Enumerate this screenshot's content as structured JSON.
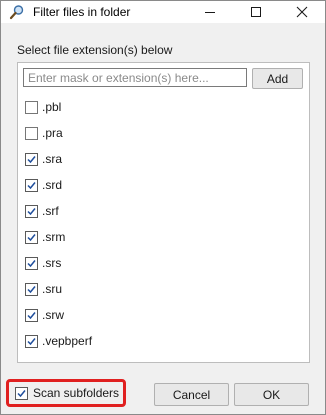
{
  "window": {
    "title": "Filter files in folder",
    "controls": {
      "minimize": "minimize-icon",
      "maximize": "maximize-icon",
      "close": "close-icon"
    },
    "title_icon": "magnifier-icon"
  },
  "instruction": "Select file extension(s) below",
  "mask": {
    "placeholder": "Enter mask or extension(s) here...",
    "value": "",
    "add_label": "Add"
  },
  "extensions": [
    {
      "label": ".pbl",
      "checked": false
    },
    {
      "label": ".pra",
      "checked": false
    },
    {
      "label": ".sra",
      "checked": true
    },
    {
      "label": ".srd",
      "checked": true
    },
    {
      "label": ".srf",
      "checked": true
    },
    {
      "label": ".srm",
      "checked": true
    },
    {
      "label": ".srs",
      "checked": true
    },
    {
      "label": ".sru",
      "checked": true
    },
    {
      "label": ".srw",
      "checked": true
    },
    {
      "label": ".vepbperf",
      "checked": true
    }
  ],
  "scan_subfolders": {
    "label": "Scan subfolders",
    "checked": true,
    "highlight_color": "#e02020"
  },
  "buttons": {
    "cancel": "Cancel",
    "ok": "OK"
  }
}
